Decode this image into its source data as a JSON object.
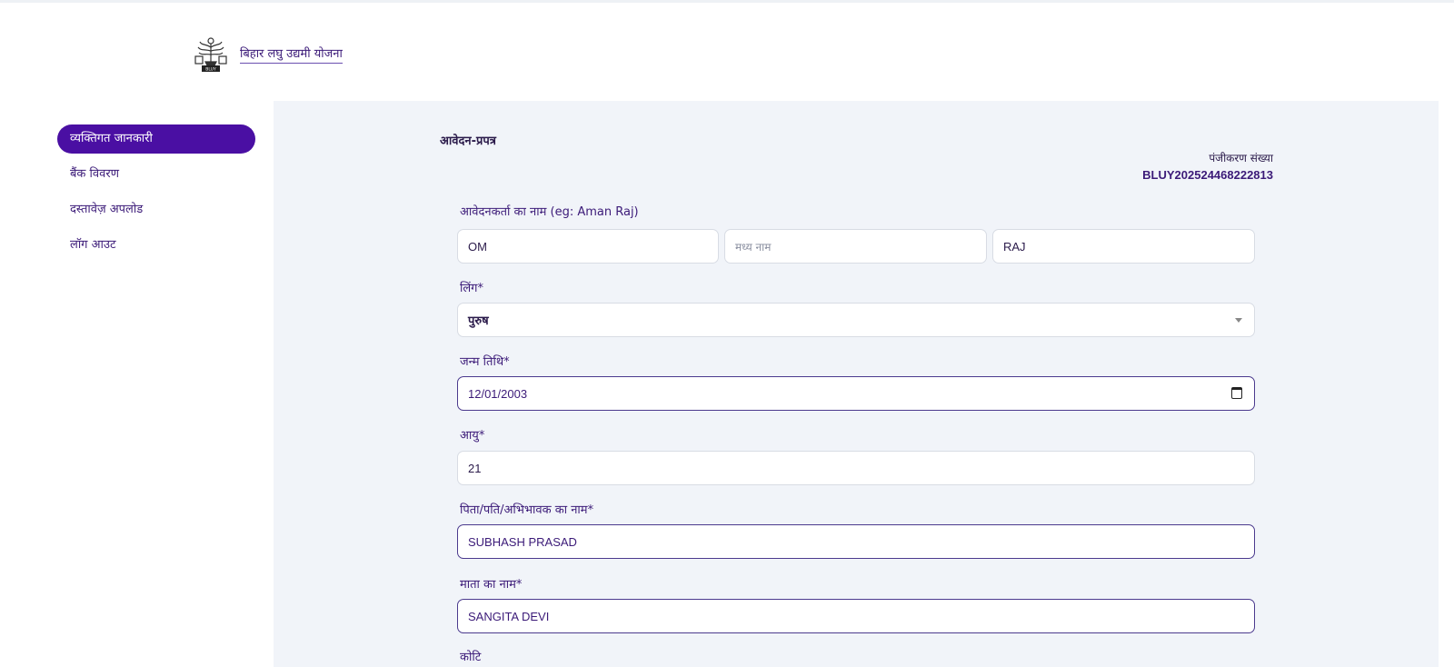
{
  "header": {
    "brand_text": "बिहार लघु उद्यमी योजना",
    "logo_text": "BLUY"
  },
  "sidebar": {
    "items": [
      {
        "label": "व्यक्तिगत जानकारी",
        "active": true
      },
      {
        "label": "बैंक विवरण",
        "active": false
      },
      {
        "label": "दस्तावेज़ अपलोड",
        "active": false
      },
      {
        "label": "लॉग आउट",
        "active": false
      }
    ]
  },
  "form": {
    "title": "आवेदन-प्रपत्र",
    "registration_label": "पंजीकरण संख्या",
    "registration_number": "BLUY202524468222813",
    "name_label": "आवेदनकर्ता का नाम (eg: Aman Raj)",
    "first_name": "OM",
    "middle_name_placeholder": "मध्य नाम",
    "last_name": "RAJ",
    "gender_label": "लिंग*",
    "gender_value": "पुरुष",
    "dob_label": "जन्म तिथि*",
    "dob_value": "12/01/2003",
    "age_label": "आयु*",
    "age_value": "21",
    "father_label": "पिता/पति/अभिभावक का नाम*",
    "father_value": "SUBHASH PRASAD",
    "mother_label": "माता का नाम*",
    "mother_value": "SANGITA DEVI",
    "category_label": "कोटि"
  },
  "colors": {
    "accent": "#4a0fa3",
    "text": "#3b1a78",
    "panel": "#f1f4f9"
  }
}
